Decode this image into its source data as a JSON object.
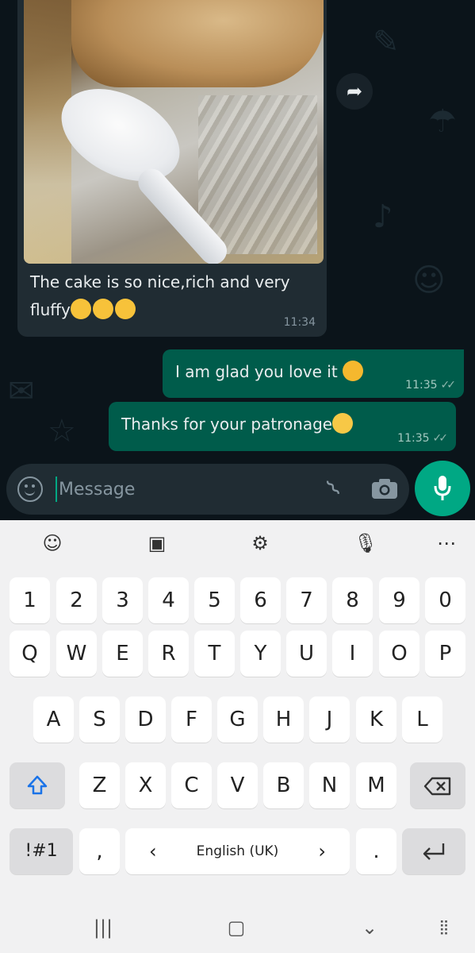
{
  "chat": {
    "incoming": {
      "caption": "The cake is so nice,rich and very fluffy",
      "emoji_count": 3,
      "time": "11:34"
    },
    "outgoing": [
      {
        "text": "I am glad you love it",
        "emoji": "hugging-face",
        "time": "11:35",
        "status": "read-ticks"
      },
      {
        "text": "Thanks for your patronage",
        "emoji": "smiling-face",
        "time": "11:35",
        "status": "read-ticks"
      }
    ]
  },
  "compose": {
    "placeholder": "Message"
  },
  "keyboard": {
    "row_numbers": [
      "1",
      "2",
      "3",
      "4",
      "5",
      "6",
      "7",
      "8",
      "9",
      "0"
    ],
    "row_top": [
      "Q",
      "W",
      "E",
      "R",
      "T",
      "Y",
      "U",
      "I",
      "O",
      "P"
    ],
    "row_home": [
      "A",
      "S",
      "D",
      "F",
      "G",
      "H",
      "J",
      "K",
      "L"
    ],
    "row_bottom": [
      "Z",
      "X",
      "C",
      "V",
      "B",
      "N",
      "M"
    ],
    "symbols_key": "!#1",
    "comma_key": ",",
    "space_label": "English (UK)",
    "space_left_arrow": "‹",
    "space_right_arrow": "›",
    "period_key": ".",
    "toolbar_icons": [
      "emoji-icon",
      "sticker-icon",
      "settings-icon",
      "voice-input-icon",
      "more-icon"
    ]
  },
  "colors": {
    "chat_bg": "#0b141a",
    "incoming_bubble": "#202c33",
    "outgoing_bubble": "#005c4b",
    "accent": "#00a884",
    "keyboard_bg": "#f1f1f2"
  }
}
